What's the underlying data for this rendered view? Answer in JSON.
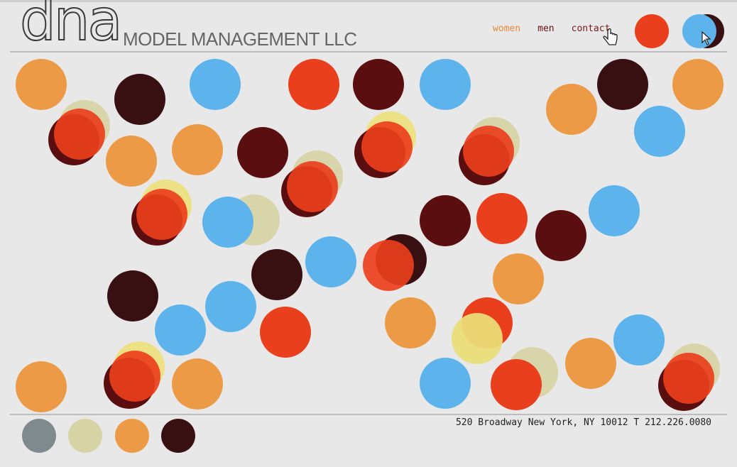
{
  "logo": {
    "mark": "dna",
    "subtitle": "MODEL MANAGEMENT LLC"
  },
  "nav": {
    "women_label": "women",
    "men_label": "men",
    "contact_label": "contact"
  },
  "colors": {
    "orange": "#ec9a45",
    "red": "#ea3f1c",
    "maroon": "#5a0e0f",
    "darkbrown": "#381012",
    "blue": "#5db3eb",
    "khaki": "#d6d3a4",
    "yellow": "#ece07a",
    "gray": "#7e8a8e",
    "nav_women": "#e58a3a",
    "nav_men": "#6a1212",
    "nav_contact": "#7a1818"
  },
  "footer": {
    "address": "520 Broadway New York, NY 10012 T 212.226.0080"
  }
}
